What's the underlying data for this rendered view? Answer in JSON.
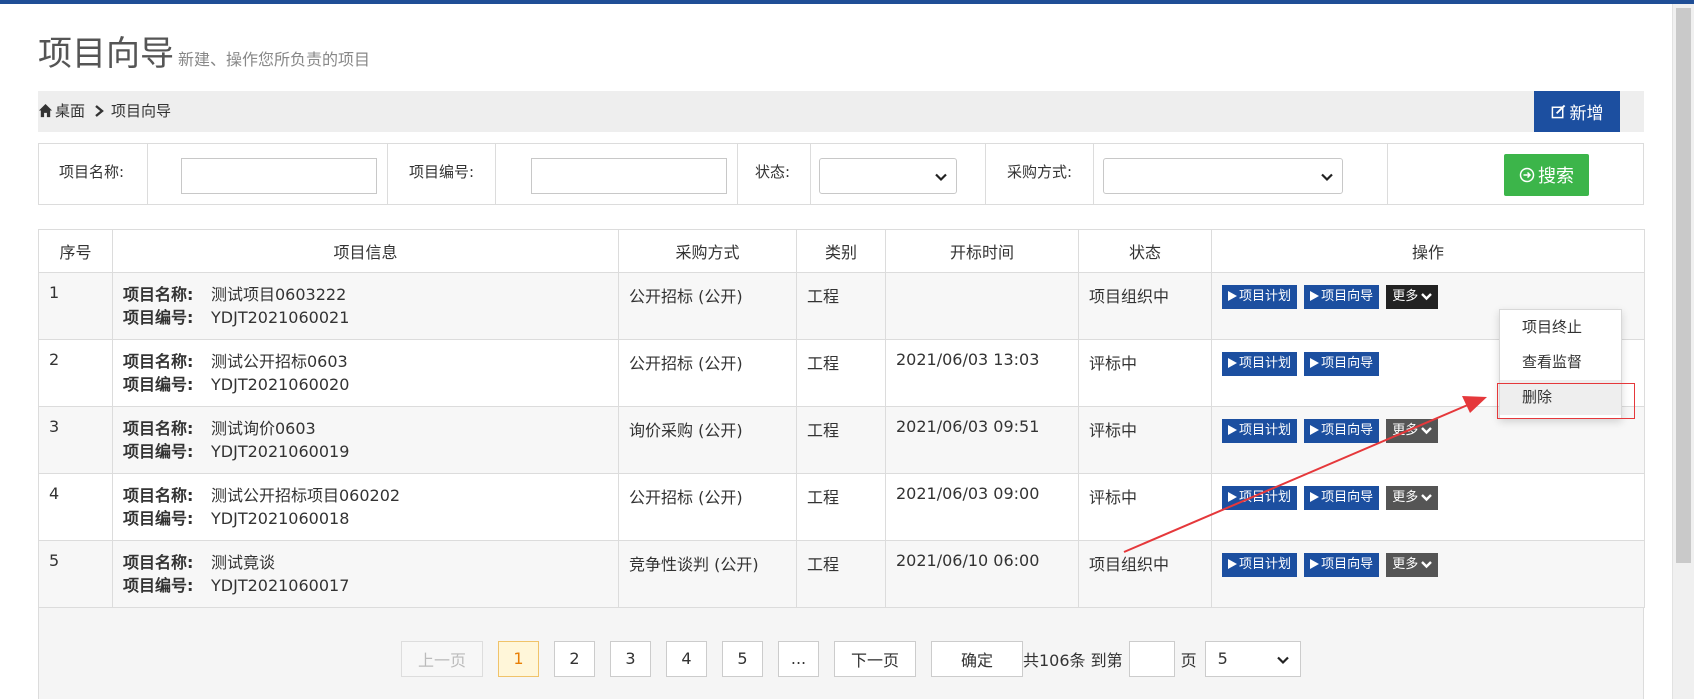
{
  "page": {
    "title": "项目向导",
    "subtitle": "新建、操作您所负责的项目"
  },
  "breadcrumb": {
    "home": "桌面",
    "current": "项目向导"
  },
  "toolbar": {
    "add_label": "新增"
  },
  "filters": {
    "name_label": "项目名称:",
    "name_value": "",
    "code_label": "项目编号:",
    "code_value": "",
    "status_label": "状态:",
    "status_value": "",
    "purchase_label": "采购方式:",
    "purchase_value": "",
    "search_label": "搜索"
  },
  "table": {
    "headers": [
      "序号",
      "项目信息",
      "采购方式",
      "类别",
      "开标时间",
      "状态",
      "操作"
    ],
    "name_key": "项目名称:",
    "code_key": "项目编号:",
    "rows": [
      {
        "no": "1",
        "name": "测试项目0603222",
        "code": "YDJT2021060021",
        "purchase": "公开招标 (公开)",
        "category": "工程",
        "open_time": "",
        "status": "项目组织中"
      },
      {
        "no": "2",
        "name": "测试公开招标0603",
        "code": "YDJT2021060020",
        "purchase": "公开招标 (公开)",
        "category": "工程",
        "open_time": "2021/06/03 13:03",
        "status": "评标中"
      },
      {
        "no": "3",
        "name": "测试询价0603",
        "code": "YDJT2021060019",
        "purchase": "询价采购 (公开)",
        "category": "工程",
        "open_time": "2021/06/03 09:51",
        "status": "评标中"
      },
      {
        "no": "4",
        "name": "测试公开招标项目060202",
        "code": "YDJT2021060018",
        "purchase": "公开招标 (公开)",
        "category": "工程",
        "open_time": "2021/06/03 09:00",
        "status": "评标中"
      },
      {
        "no": "5",
        "name": "测试竟谈",
        "code": "YDJT2021060017",
        "purchase": "竞争性谈判 (公开)",
        "category": "工程",
        "open_time": "2021/06/10 06:00",
        "status": "项目组织中"
      }
    ],
    "actions": {
      "plan": "项目计划",
      "guide": "项目向导",
      "more": "更多"
    }
  },
  "dropdown": {
    "items": [
      "项目终止",
      "查看监督",
      "删除"
    ]
  },
  "pagination": {
    "prev": "上一页",
    "pages": [
      "1",
      "2",
      "3",
      "4",
      "5"
    ],
    "ellipsis": "...",
    "next": "下一页",
    "confirm": "确定",
    "total_text": "共106条 到第",
    "goto_value": "",
    "page_suffix": "页",
    "page_size": "5"
  },
  "colors": {
    "primary": "#1c4fa0",
    "success": "#3cb54a",
    "annotation": "#e5383b"
  }
}
